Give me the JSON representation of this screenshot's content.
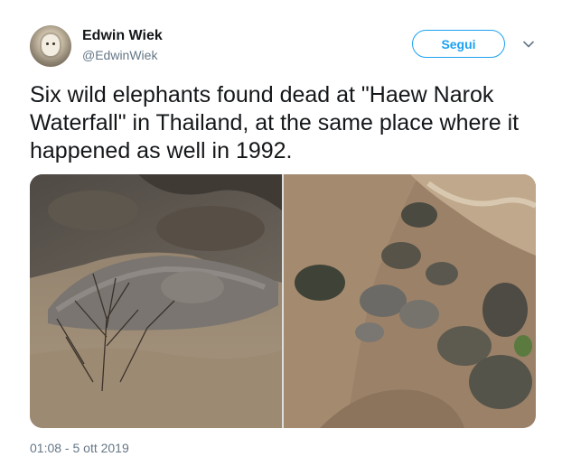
{
  "user": {
    "name": "Edwin Wiek",
    "handle": "@EdwinWiek",
    "avatar_icon": "monkey-avatar"
  },
  "follow_label": "Segui",
  "menu_icon": "chevron-down-icon",
  "tweet_text": "Six wild elephants found dead at \"Haew Narok Waterfall\" in Thailand, at the same place where it happened as well in 1992.",
  "media": {
    "left_photo": "elephant-in-water-photo",
    "right_photo": "waterfall-rocks-elephants-photo"
  },
  "timestamp": "01:08 - 5 ott 2019",
  "colors": {
    "accent": "#1da1f2",
    "secondary_text": "#657786",
    "text": "#14171a"
  }
}
